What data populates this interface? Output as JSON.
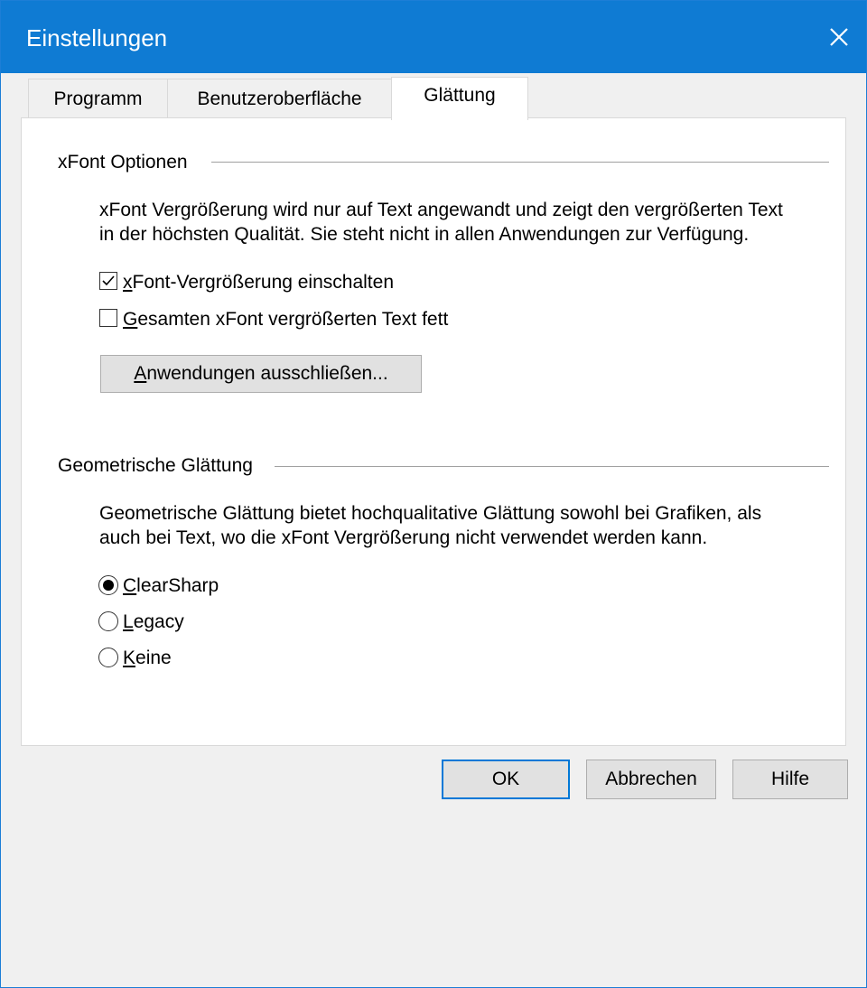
{
  "window": {
    "title": "Einstellungen"
  },
  "tabs": [
    {
      "label": "Programm",
      "active": false
    },
    {
      "label": "Benutzeroberfläche",
      "active": false
    },
    {
      "label": "Glättung",
      "active": true
    }
  ],
  "xfont": {
    "group_label": "xFont Optionen",
    "description_line1": "xFont Vergrößerung wird nur auf Text angewandt und zeigt den vergrößerten Text",
    "description_line2": "in der höchsten Qualität. Sie steht nicht in allen Anwendungen zur Verfügung.",
    "enable": {
      "mnemonic": "x",
      "rest": "Font-Vergrößerung einschalten",
      "checked": true
    },
    "bold": {
      "mnemonic": "G",
      "rest": "esamten xFont vergrößerten Text fett",
      "checked": false
    },
    "exclude_button": {
      "mnemonic": "A",
      "rest": "nwendungen ausschließen..."
    }
  },
  "geometric": {
    "group_label": "Geometrische Glättung",
    "description_line1": "Geometrische Glättung bietet hochqualitative Glättung sowohl bei Grafiken, als",
    "description_line2": "auch bei Text, wo die xFont Vergrößerung nicht verwendet werden kann.",
    "options": [
      {
        "mnemonic": "C",
        "rest": "learSharp",
        "selected": true
      },
      {
        "mnemonic": "L",
        "rest": "egacy",
        "selected": false
      },
      {
        "mnemonic": "K",
        "rest": "eine",
        "selected": false
      }
    ]
  },
  "buttons": {
    "ok": "OK",
    "cancel": "Abbrechen",
    "help": "Hilfe"
  },
  "colors": {
    "titlebar": "#0f7bd3",
    "focus": "#0078d7"
  },
  "icons": {
    "close": "close-icon",
    "check": "checkmark-icon"
  }
}
